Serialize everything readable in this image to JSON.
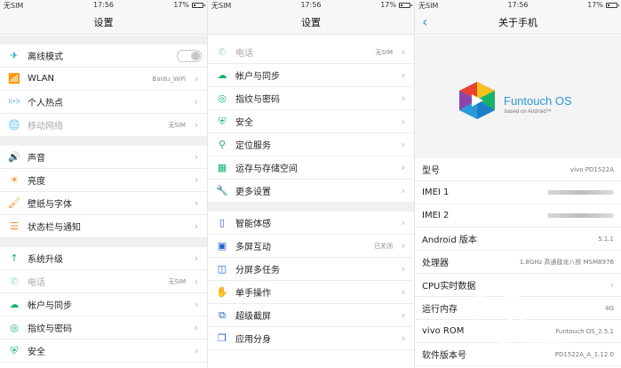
{
  "status": {
    "carrier": "无SIM",
    "time": "17:56",
    "battery": "17%"
  },
  "panel1": {
    "title": "设置",
    "group1": [
      {
        "label": "离线模式",
        "icon": "airplane-icon",
        "type": "toggle"
      },
      {
        "label": "WLAN",
        "icon": "wifi-icon",
        "value": "Baidu_WiFi"
      },
      {
        "label": "个人热点",
        "icon": "hotspot-icon"
      },
      {
        "label": "移动网络",
        "icon": "globe-icon",
        "value": "无SIM",
        "disabled": true
      }
    ],
    "group2": [
      {
        "label": "声音",
        "icon": "speaker-icon"
      },
      {
        "label": "亮度",
        "icon": "sun-icon"
      },
      {
        "label": "壁纸与字体",
        "icon": "brush-icon"
      },
      {
        "label": "状态栏与通知",
        "icon": "statusbar-icon"
      }
    ],
    "group3": [
      {
        "label": "系统升级",
        "icon": "upgrade-arrow-icon"
      },
      {
        "label": "电话",
        "icon": "phone-icon",
        "value": "无SIM",
        "disabled": true
      },
      {
        "label": "帐户与同步",
        "icon": "cloud-icon"
      },
      {
        "label": "指纹与密码",
        "icon": "fingerprint-icon"
      },
      {
        "label": "安全",
        "icon": "shield-icon"
      }
    ]
  },
  "panel2": {
    "title": "设置",
    "group1": [
      {
        "label": "电话",
        "icon": "phone-icon",
        "value": "无SIM",
        "disabled": true
      },
      {
        "label": "帐户与同步",
        "icon": "cloud-icon"
      },
      {
        "label": "指纹与密码",
        "icon": "fingerprint-icon"
      },
      {
        "label": "安全",
        "icon": "shield-icon"
      },
      {
        "label": "定位服务",
        "icon": "location-icon"
      },
      {
        "label": "运存与存储空间",
        "icon": "storage-icon"
      },
      {
        "label": "更多设置",
        "icon": "wrench-icon"
      }
    ],
    "group2": [
      {
        "label": "智能体感",
        "icon": "vibrate-icon"
      },
      {
        "label": "多屏互动",
        "icon": "cast-icon",
        "value": "已关闭"
      },
      {
        "label": "分屏多任务",
        "icon": "split-screen-icon"
      },
      {
        "label": "单手操作",
        "icon": "hand-icon"
      },
      {
        "label": "超级截屏",
        "icon": "screenshot-icon"
      },
      {
        "label": "应用分身",
        "icon": "clone-icon"
      }
    ]
  },
  "panel3": {
    "title": "关于手机",
    "logo_text": "Funtouch OS",
    "logo_sub": "based on Android™",
    "rows": [
      {
        "label": "型号",
        "value": "vivo PD1522A"
      },
      {
        "label": "IMEI 1",
        "blurred": true
      },
      {
        "label": "IMEI 2",
        "blurred": true
      },
      {
        "label": "Android 版本",
        "value": "5.1.1"
      },
      {
        "label": "处理器",
        "value": "1.8GHz 高通骁龙八核 MSM8976"
      },
      {
        "label": "CPU实时数据",
        "chevron": true
      },
      {
        "label": "运行内存",
        "value": "4G"
      },
      {
        "label": "vivo ROM",
        "value": "Funtouch OS_2.5.1"
      },
      {
        "label": "软件版本号",
        "value": "PD1522A_A_1.12.0"
      }
    ]
  },
  "watermark": {
    "line1": "智能手机网",
    "line2": "百度贴吧下载"
  },
  "colors": {
    "accent": "#2a9ad8",
    "orange": "#f28a1c",
    "green": "#16b36b"
  }
}
